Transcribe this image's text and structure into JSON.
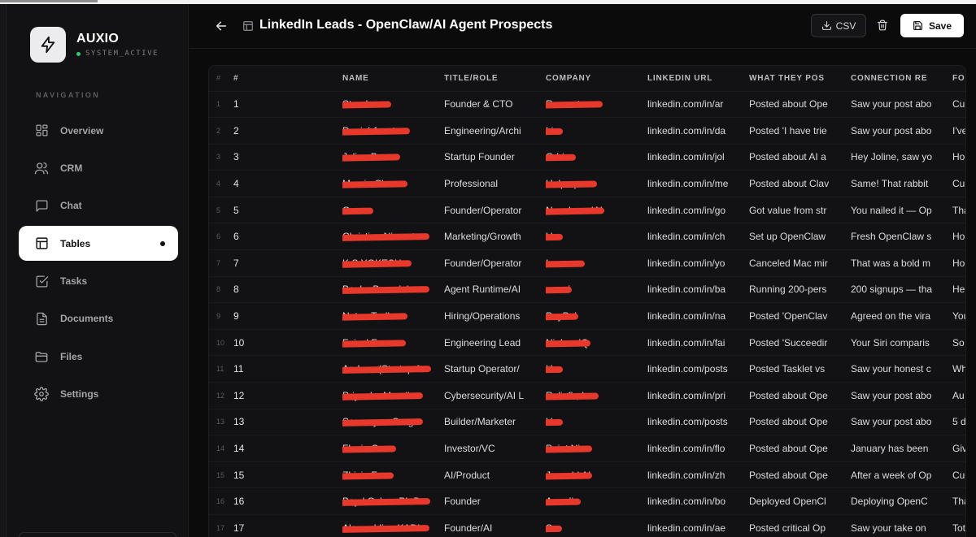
{
  "app": {
    "name": "AUXIO",
    "status": "SYSTEM_ACTIVE",
    "status_color": "#2ecc71"
  },
  "sidebar": {
    "heading": "NAVIGATION",
    "items": [
      {
        "label": "Overview",
        "icon": "grid-icon",
        "active": false
      },
      {
        "label": "CRM",
        "icon": "users-icon",
        "active": false
      },
      {
        "label": "Chat",
        "icon": "message-icon",
        "active": false
      },
      {
        "label": "Tables",
        "icon": "table-icon",
        "active": true
      },
      {
        "label": "Tasks",
        "icon": "checkbox-icon",
        "active": false
      },
      {
        "label": "Documents",
        "icon": "document-icon",
        "active": false
      },
      {
        "label": "Files",
        "icon": "folder-icon",
        "active": false
      },
      {
        "label": "Settings",
        "icon": "gear-icon",
        "active": false
      }
    ]
  },
  "header": {
    "title": "LinkedIn Leads - OpenClaw/AI Agent Prospects",
    "csv_label": "CSV",
    "save_label": "Save"
  },
  "table": {
    "columns": [
      "#",
      "#",
      "NAME",
      "TITLE/ROLE",
      "COMPANY",
      "LINKEDIN URL",
      "WHAT THEY POS",
      "CONNECTION RE",
      "FO"
    ],
    "rows": [
      {
        "n": "1",
        "idx": "1",
        "name": "Standa...",
        "title": "Founder & CTO",
        "company": "Remout.com",
        "url": "linkedin.com/in/ar",
        "posted": "Posted about Ope",
        "conn": "Saw your post abo",
        "fo": "Cu"
      },
      {
        "n": "2",
        "idx": "2",
        "name": "Daniel Arcuta",
        "title": "Engineering/Archi",
        "company": "Li...",
        "url": "linkedin.com/in/da",
        "posted": "Posted 'I have trie",
        "conn": "Saw your post abo",
        "fo": "I've"
      },
      {
        "n": "3",
        "idx": "3",
        "name": "Joline Bu...",
        "title": "Startup Founder",
        "company": "Orbios",
        "url": "linkedin.com/in/jol",
        "posted": "Posted about AI a",
        "conn": "Hey Joline, saw yo",
        "fo": "Ho"
      },
      {
        "n": "4",
        "idx": "4",
        "name": "Mervin Chan",
        "title": "Professional",
        "company": "Helpsquare",
        "url": "linkedin.com/in/me",
        "posted": "Posted about Clav",
        "conn": "Same! That rabbit",
        "fo": "Cu"
      },
      {
        "n": "5",
        "idx": "5",
        "name": "Go...",
        "title": "Founder/Operator",
        "company": "NovabrandAI",
        "url": "linkedin.com/in/go",
        "posted": "Got value from str",
        "conn": "You nailed it — Op",
        "fo": "Tha"
      },
      {
        "n": "6",
        "idx": "6",
        "name": "Christian Niemetz",
        "title": "Marketing/Growth",
        "company": "U...",
        "url": "linkedin.com/in/ch",
        "posted": "Set up OpenClaw",
        "conn": "Fresh OpenClaw s",
        "fo": "Ho"
      },
      {
        "n": "7",
        "idx": "7",
        "name": "K.S.YOKESH",
        "title": "Founder/Operator",
        "company": "Increase",
        "url": "linkedin.com/in/yo",
        "posted": "Canceled Mac mir",
        "conn": "That was a bold m",
        "fo": "Ho"
      },
      {
        "n": "8",
        "idx": "8",
        "name": "Bauke Brenninkm",
        "title": "Agent Runtime/AI",
        "company": "ora.ai",
        "url": "linkedin.com/in/ba",
        "posted": "Running 200-pers",
        "conn": "200 signups — tha",
        "fo": "He"
      },
      {
        "n": "9",
        "idx": "9",
        "name": "Natan Trelka",
        "title": "Hiring/Operations",
        "company": "PayPal",
        "url": "linkedin.com/in/na",
        "posted": "Posted 'OpenClav",
        "conn": "Agreed on the vira",
        "fo": "You"
      },
      {
        "n": "10",
        "idx": "10",
        "name": "Faisal Feroz",
        "title": "Engineering Lead",
        "company": "NielsenIQ",
        "url": "linkedin.com/in/fai",
        "posted": "Posted 'Succeedir",
        "conn": "Your Siri comparis",
        "fo": "So"
      },
      {
        "n": "11",
        "idx": "11",
        "name": "Andrew (Startup A",
        "title": "Startup Operator/",
        "company": "U...",
        "url": "linkedin.com/posts",
        "posted": "Posted Tasklet vs",
        "conn": "Saw your honest c",
        "fo": "Wh"
      },
      {
        "n": "12",
        "idx": "12",
        "name": "Priyanka Mandh",
        "title": "Cybersecurity/AI L",
        "company": "Reliefh, Inc.",
        "url": "linkedin.com/in/pri",
        "posted": "Posted about Ope",
        "conn": "Saw your post abo",
        "fo": "Au"
      },
      {
        "n": "13",
        "idx": "13",
        "name": "Samanyou Garg",
        "title": "Builder/Marketer",
        "company": "U...",
        "url": "linkedin.com/posts",
        "posted": "Posted about Ope",
        "conn": "Saw your post abo",
        "fo": "5 d"
      },
      {
        "n": "14",
        "idx": "14",
        "name": "Flavio C...",
        "title": "Investor/VC",
        "company": "Point Nine",
        "url": "linkedin.com/in/flo",
        "posted": "Posted about Ope",
        "conn": "January has been",
        "fo": "Giv"
      },
      {
        "n": "15",
        "idx": "15",
        "name": "Zhixin F...",
        "title": "AI/Product",
        "company": "Jeworld AI",
        "url": "linkedin.com/in/zh",
        "posted": "Posted about Ope",
        "conn": "After a week of Op",
        "fo": "Cu"
      },
      {
        "n": "16",
        "idx": "16",
        "name": "Boyd Cohen Ph.D",
        "title": "Founder",
        "company": "Arcadia",
        "url": "linkedin.com/in/bo",
        "posted": "Deployed OpenCl",
        "conn": "Deploying OpenC",
        "fo": "Tha"
      },
      {
        "n": "17",
        "idx": "17",
        "name": "Alae-eddine KADI",
        "title": "Founder/AI",
        "company": "S...",
        "url": "linkedin.com/in/ae",
        "posted": "Posted critical Op",
        "conn": "Saw your take on",
        "fo": "Tot"
      }
    ]
  },
  "colors": {
    "accent": "#ffffff",
    "background": "#0b0b0c",
    "redaction": "#e8382b"
  }
}
